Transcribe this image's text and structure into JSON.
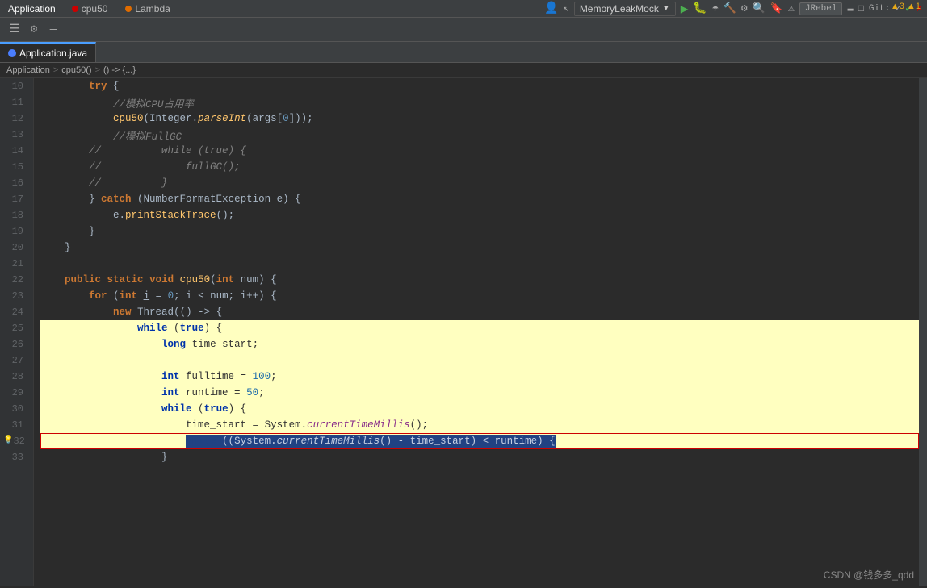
{
  "menubar": {
    "items": [
      "Application",
      "cpu50",
      "Lambda"
    ],
    "run_config": "MemoryLeakMock",
    "jrebel": "JRebel",
    "git": "Git:"
  },
  "toolbar": {
    "icons": [
      "≡",
      "⚙",
      "—"
    ]
  },
  "tabs": [
    {
      "label": "Application.java",
      "active": true,
      "type": "java"
    }
  ],
  "breadcrumb": {
    "parts": [
      "Application",
      "cpu50()",
      "() -> {...}"
    ]
  },
  "warning_badge": "▲3 ▲1",
  "lines": [
    {
      "num": 10,
      "content": "        try {",
      "indent": 2
    },
    {
      "num": 11,
      "content": "            //模拟CPU占用率",
      "type": "comment",
      "indent": 3
    },
    {
      "num": 12,
      "content": "            cpu50(Integer.parseInt(args[0]));",
      "indent": 3
    },
    {
      "num": 13,
      "content": "            //模拟FullGC",
      "type": "comment",
      "indent": 3
    },
    {
      "num": 14,
      "content": "        //          while (true) {",
      "type": "commented-code",
      "indent": 2
    },
    {
      "num": 15,
      "content": "        //              fullGC();",
      "type": "commented-code",
      "indent": 2
    },
    {
      "num": 16,
      "content": "        //          }",
      "type": "commented-code",
      "indent": 2
    },
    {
      "num": 17,
      "content": "        } catch (NumberFormatException e) {",
      "indent": 2
    },
    {
      "num": 18,
      "content": "            e.printStackTrace();",
      "indent": 3
    },
    {
      "num": 19,
      "content": "        }",
      "indent": 2
    },
    {
      "num": 20,
      "content": "    }",
      "indent": 1
    },
    {
      "num": 21,
      "content": "",
      "indent": 0
    },
    {
      "num": 22,
      "content": "    public static void cpu50(int num) {",
      "indent": 1
    },
    {
      "num": 23,
      "content": "        for (int i = 0; i < num; i++) {",
      "indent": 2
    },
    {
      "num": 24,
      "content": "            new Thread(() -> {",
      "indent": 3,
      "has_fold": true
    },
    {
      "num": 25,
      "content": "                while (true) {",
      "indent": 4,
      "highlighted": true
    },
    {
      "num": 26,
      "content": "                    long time_start;",
      "indent": 5,
      "highlighted": true
    },
    {
      "num": 27,
      "content": "",
      "indent": 0,
      "highlighted": true
    },
    {
      "num": 28,
      "content": "                    int fulltime = 100;",
      "indent": 5,
      "highlighted": true
    },
    {
      "num": 29,
      "content": "                    int runtime = 50;",
      "indent": 5,
      "highlighted": true
    },
    {
      "num": 30,
      "content": "                    while (true) {",
      "indent": 5,
      "highlighted": true
    },
    {
      "num": 31,
      "content": "                        time_start = System.currentTimeMillis();",
      "indent": 6,
      "highlighted": true
    },
    {
      "num": 32,
      "content": "                        while ((System.currentTimeMillis() - time_start) < runtime) {",
      "indent": 6,
      "highlighted": true,
      "selected": true,
      "has_lightbulb": true
    },
    {
      "num": 33,
      "content": "                    }",
      "indent": 5
    }
  ],
  "watermark": "CSDN @钱多多_qdd"
}
